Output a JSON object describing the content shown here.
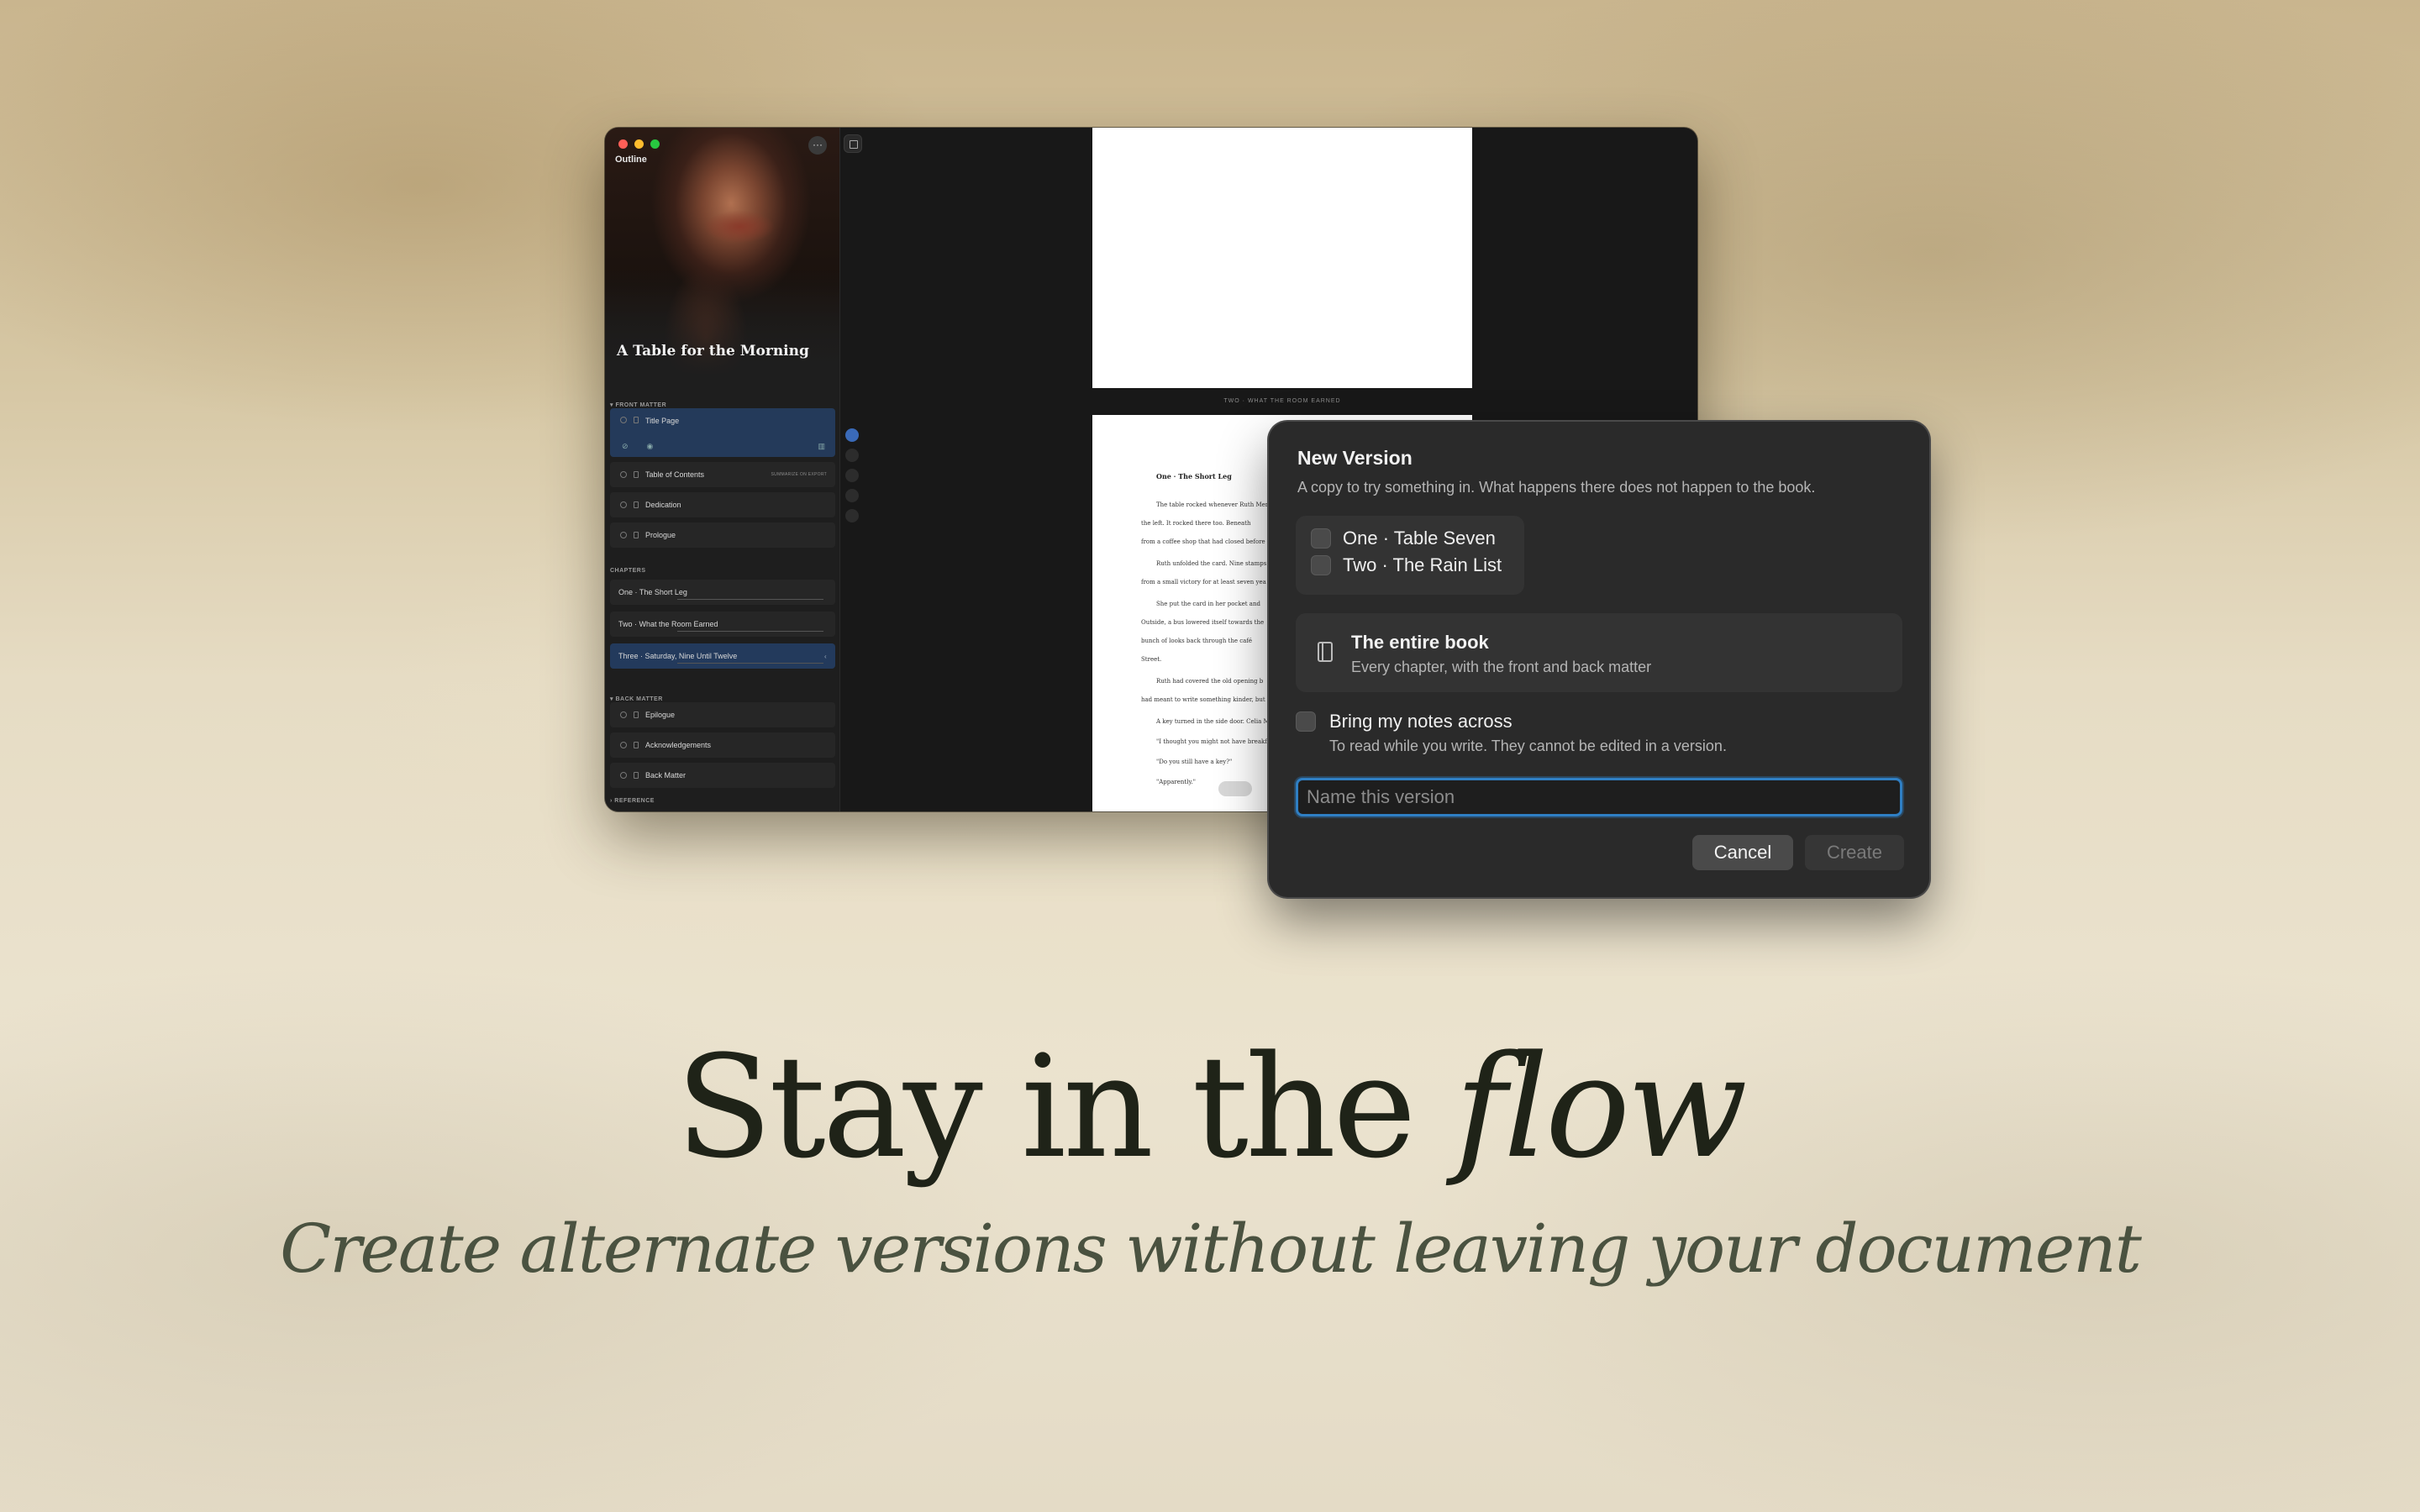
{
  "window": {
    "sidebar_title": "Outline",
    "more_label": "···",
    "book_title": "A Table for the Morning",
    "sections": {
      "front_matter": "▾ FRONT MATTER",
      "chapters": "CHAPTERS",
      "back_matter": "▾ BACK MATTER",
      "reference": "› REFERENCE"
    },
    "front_items": [
      "Title Page",
      "Table of Contents",
      "Dedication",
      "Prologue"
    ],
    "toc_badge": "SUMMARIZE ON EXPORT",
    "chapters": [
      "One · The Short Leg",
      "Two · What the Room Earned",
      "Three · Saturday, Nine Until Twelve"
    ],
    "active_chapter_mark": "‹",
    "back_items": [
      "Epilogue",
      "Acknowledgements",
      "Back Matter"
    ],
    "chapter_caption": "TWO · WHAT THE ROOM EARNED",
    "page_heading": "One · The Short Leg",
    "page_lines": [
      "The table rocked whenever Ruth Mer",
      "the left. It rocked there too. Beneath",
      "from a coffee shop that had closed before",
      "Ruth unfolded the card. Nine stamps",
      "from a small victory for at least seven yea",
      "She put the card in her pocket and",
      "Outside, a bus lowered itself towards the",
      "bunch of looks back through the café",
      "Street.",
      "Ruth had covered the old opening b",
      "had meant to write something kinder, but",
      "A key turned in the side door. Celia M",
      "\"I thought you might not have breakf",
      "\"Do you still have a key?\"",
      "\"Apparently.\""
    ]
  },
  "dialog": {
    "title": "New Version",
    "subtitle": "A copy to try something in. What happens there does not happen to the book.",
    "chapter_options": [
      "One · Table Seven",
      "Two · The Rain List"
    ],
    "scope_title": "The entire book",
    "scope_subtitle": "Every chapter, with the front and back matter",
    "notes_title": "Bring my notes across",
    "notes_subtitle": "To read while you write. They cannot be edited in a version.",
    "name_placeholder": "Name this version",
    "name_value": "",
    "cancel_label": "Cancel",
    "create_label": "Create",
    "accent_color": "#2f7fc4"
  },
  "marketing": {
    "headline_plain": "Stay in the ",
    "headline_italic": "flow",
    "subline": "Create alternate versions without leaving your document"
  }
}
